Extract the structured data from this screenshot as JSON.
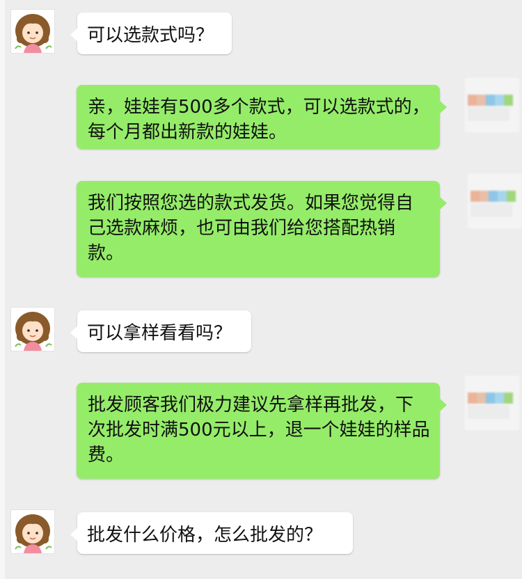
{
  "chat": {
    "messages": [
      {
        "sender": "customer",
        "text": "可以选款式吗？"
      },
      {
        "sender": "seller",
        "text": "亲，娃娃有500多个款式，可以选款式的，每个月都出新款的娃娃。"
      },
      {
        "sender": "seller",
        "text": "我们按照您选的款式发货。如果您觉得自己选款麻烦，也可由我们给您搭配热销款。"
      },
      {
        "sender": "customer",
        "text": "可以拿样看看吗？"
      },
      {
        "sender": "seller",
        "text": "批发顾客我们极力建议先拿样再批发，下次批发时满500元以上，退一个娃娃的样品费。"
      },
      {
        "sender": "customer",
        "text": "批发什么价格，怎么批发的？"
      }
    ]
  },
  "colors": {
    "background": "#ededed",
    "incoming_bubble": "#ffffff",
    "outgoing_bubble": "#95ec69"
  },
  "icons": {
    "customer_avatar": "cartoon-girl-avatar-icon",
    "seller_avatar": "blurred-avatar-icon"
  }
}
